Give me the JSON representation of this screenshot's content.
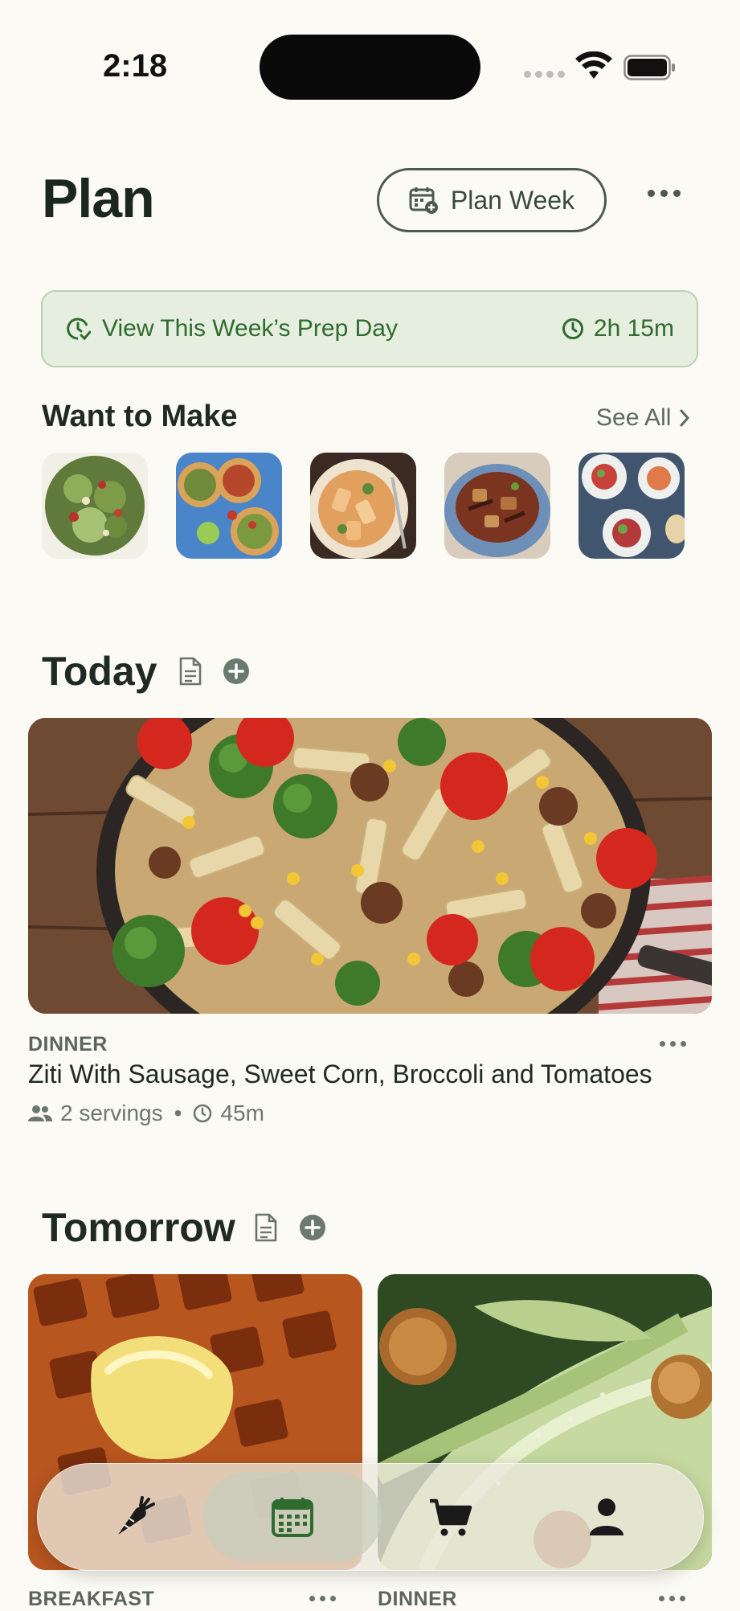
{
  "status_bar": {
    "time": "2:18"
  },
  "header": {
    "title": "Plan",
    "plan_week_label": "Plan Week"
  },
  "prep_banner": {
    "label": "View This Week’s Prep Day",
    "duration": "2h 15m"
  },
  "want_to_make": {
    "title": "Want to Make",
    "see_all": "See All",
    "thumbnails": [
      "salad",
      "tostadas",
      "pasta",
      "stir-fry",
      "plated-dishes"
    ]
  },
  "today": {
    "title": "Today",
    "meal": {
      "type": "DINNER",
      "name": "Ziti With Sausage, Sweet Corn, Broccoli and Tomatoes",
      "servings": "2 servings",
      "separator": "•",
      "time": "45m"
    }
  },
  "tomorrow": {
    "title": "Tomorrow",
    "meals": [
      {
        "type": "BREAKFAST"
      },
      {
        "type": "DINNER"
      }
    ]
  },
  "tab_bar": {
    "items": [
      {
        "name": "recipes",
        "icon": "carrot-icon"
      },
      {
        "name": "plan",
        "icon": "calendar-icon",
        "active": true
      },
      {
        "name": "grocery",
        "icon": "cart-icon"
      },
      {
        "name": "profile",
        "icon": "person-icon"
      }
    ]
  },
  "colors": {
    "background": "#fcfaf4",
    "accent_green": "#2e6b2f",
    "banner_bg": "#e6efdf"
  }
}
